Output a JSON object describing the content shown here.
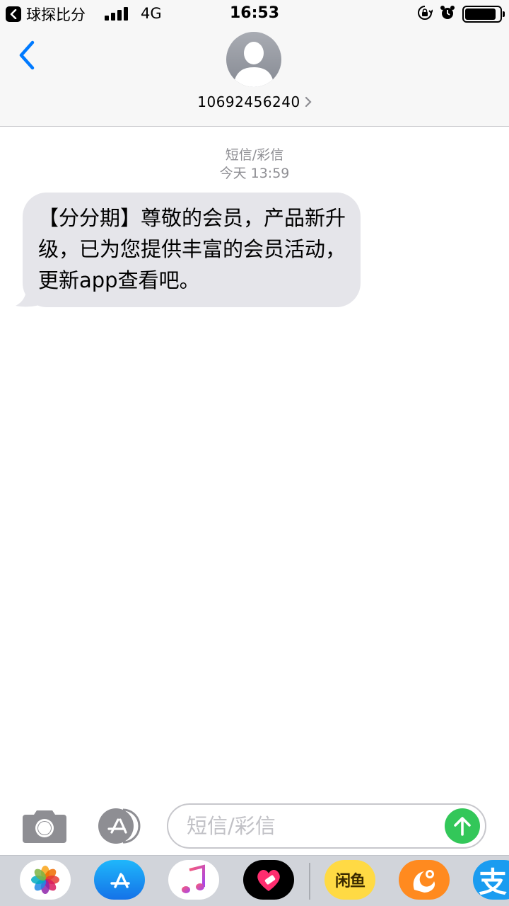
{
  "status_bar": {
    "back_app_label": "球探比分",
    "network": "4G",
    "time": "16:53",
    "icons": [
      "back-arrow-icon",
      "signal-bars-icon",
      "rotation-lock-icon",
      "alarm-icon",
      "battery-icon"
    ],
    "battery_level": 0.9
  },
  "header": {
    "back_icon": "chevron-left-icon",
    "avatar_icon": "person-silhouette-icon",
    "contact_number": "10692456240",
    "detail_icon": "chevron-right-icon"
  },
  "conversation": {
    "message_type": "短信/彩信",
    "timestamp": "今天 13:59",
    "messages": [
      {
        "direction": "incoming",
        "text": "【分分期】尊敬的会员，产品新升级，已为您提供丰富的会员活动，更新app查看吧。"
      }
    ]
  },
  "input_bar": {
    "placeholder": "短信/彩信",
    "value": "",
    "camera_icon": "camera-icon",
    "apps_icon": "app-store-icon",
    "send_icon": "arrow-up-icon"
  },
  "app_strip": {
    "apps": [
      {
        "name": "photos",
        "icon": "photos-icon"
      },
      {
        "name": "app-store",
        "icon": "app-store-icon"
      },
      {
        "name": "music",
        "icon": "music-note-icon"
      },
      {
        "name": "digital-touch",
        "icon": "heart-icon"
      },
      {
        "name": "xianyu",
        "icon": "xianyu-icon",
        "label": "闲鱼"
      },
      {
        "name": "uc-browser",
        "icon": "uc-browser-icon"
      },
      {
        "name": "alipay",
        "icon": "alipay-icon",
        "label": "支"
      }
    ]
  },
  "colors": {
    "accent_blue": "#007aff",
    "bubble_gray": "#e5e5ea",
    "send_green": "#33c759",
    "meta_gray": "#8e8e93"
  }
}
